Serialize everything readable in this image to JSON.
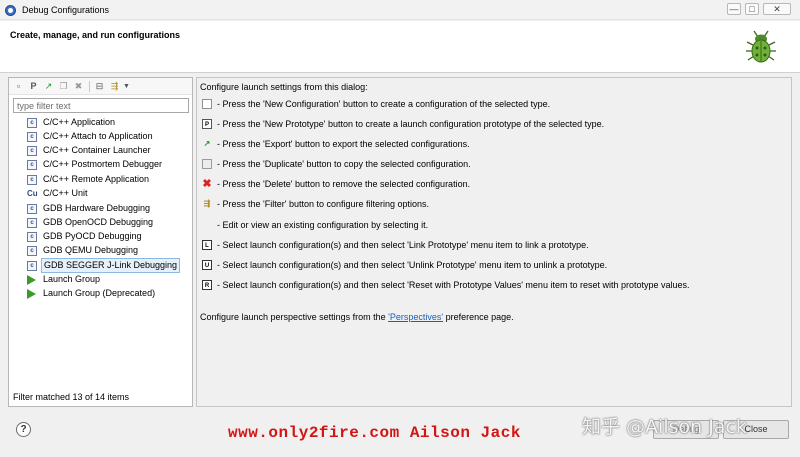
{
  "window": {
    "title": "Debug Configurations",
    "min_glyph": "—",
    "max_glyph": "□",
    "close_glyph": "✕"
  },
  "header": {
    "subtitle": "Create, manage, and run configurations"
  },
  "left": {
    "filter_placeholder": "type filter text",
    "items": [
      {
        "label": "C/C++ Application",
        "icon": "c-config-icon"
      },
      {
        "label": "C/C++ Attach to Application",
        "icon": "c-config-icon"
      },
      {
        "label": "C/C++ Container Launcher",
        "icon": "c-config-icon"
      },
      {
        "label": "C/C++ Postmortem Debugger",
        "icon": "c-config-icon"
      },
      {
        "label": "C/C++ Remote Application",
        "icon": "c-config-icon"
      },
      {
        "label": "C/C++ Unit",
        "icon": "cu-config-icon"
      },
      {
        "label": "GDB Hardware Debugging",
        "icon": "c-config-icon"
      },
      {
        "label": "GDB OpenOCD Debugging",
        "icon": "c-config-icon"
      },
      {
        "label": "GDB PyOCD Debugging",
        "icon": "c-config-icon"
      },
      {
        "label": "GDB QEMU Debugging",
        "icon": "c-config-icon"
      },
      {
        "label": "GDB SEGGER J-Link Debugging",
        "icon": "c-config-icon",
        "selected": true
      },
      {
        "label": "Launch Group",
        "icon": "launch-group-icon"
      },
      {
        "label": "Launch Group (Deprecated)",
        "icon": "launch-group-icon"
      }
    ],
    "status": "Filter matched 13 of 14 items"
  },
  "right": {
    "intro": "Configure launch settings from this dialog:",
    "rows": [
      {
        "icon": "new-configuration-icon",
        "glyph": "",
        "text": "- Press the 'New Configuration' button to create a configuration of the selected type."
      },
      {
        "icon": "new-prototype-icon",
        "glyph": "P",
        "text": "- Press the 'New Prototype' button to create a launch configuration prototype of the selected type."
      },
      {
        "icon": "export-icon",
        "glyph": "↗",
        "text": "- Press the 'Export' button to export the selected configurations."
      },
      {
        "icon": "duplicate-icon",
        "glyph": "",
        "text": "- Press the 'Duplicate' button to copy the selected configuration."
      },
      {
        "icon": "delete-icon",
        "glyph": "✖",
        "text": "- Press the 'Delete' button to remove the selected configuration."
      },
      {
        "icon": "filter-icon",
        "glyph": "⇶",
        "text": "- Press the 'Filter' button to configure filtering options."
      },
      {
        "icon": "",
        "glyph": "",
        "text": "- Edit or view an existing configuration by selecting it."
      },
      {
        "icon": "link-prototype-icon",
        "glyph": "L",
        "text": "- Select launch configuration(s) and then select 'Link Prototype' menu item to link a prototype."
      },
      {
        "icon": "unlink-prototype-icon",
        "glyph": "U",
        "text": "- Select launch configuration(s) and then select 'Unlink Prototype' menu item to unlink a prototype."
      },
      {
        "icon": "reset-prototype-icon",
        "glyph": "R",
        "text": "- Select launch configuration(s) and then select 'Reset with Prototype Values' menu item to reset with prototype values."
      }
    ],
    "footer_pre": "Configure launch perspective settings from the ",
    "footer_link": "'Perspectives'",
    "footer_post": " preference page."
  },
  "bottom": {
    "help_glyph": "?",
    "debug_label": "Debug",
    "close_label": "Close",
    "watermark": "www.only2fire.com Ailson Jack",
    "zhihu_watermark": "知乎 @Ailson Jack"
  }
}
